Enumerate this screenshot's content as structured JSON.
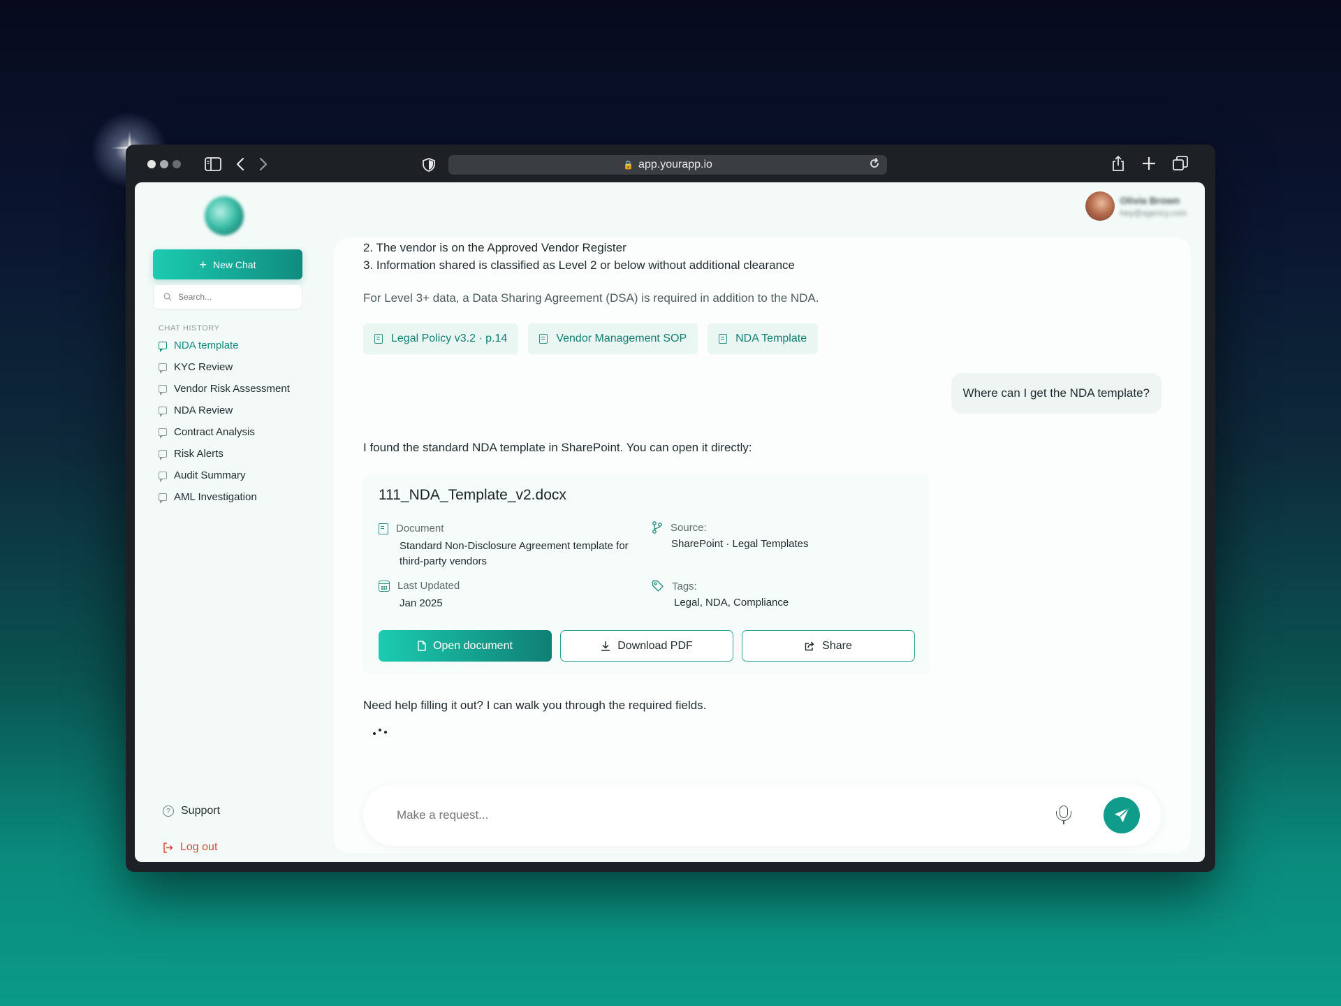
{
  "browser": {
    "url": "app.yourapp.io"
  },
  "sidebar": {
    "new_chat_label": "New Chat",
    "search_placeholder": "Search...",
    "history_label": "CHAT HISTORY",
    "items": [
      {
        "label": "NDA template",
        "active": true
      },
      {
        "label": "KYC Review",
        "active": false
      },
      {
        "label": "Vendor Risk Assessment",
        "active": false
      },
      {
        "label": "NDA Review",
        "active": false
      },
      {
        "label": "Contract Analysis",
        "active": false
      },
      {
        "label": "Risk Alerts",
        "active": false
      },
      {
        "label": "Audit Summary",
        "active": false
      },
      {
        "label": "AML Investigation",
        "active": false
      }
    ],
    "support_label": "Support",
    "logout_label": "Log out"
  },
  "profile": {
    "name": "Olivia Brown",
    "email": "hey@agency.com"
  },
  "chat": {
    "assistant_lines": [
      "2. The vendor is on the Approved Vendor Register",
      "3. Information shared is classified as Level 2 or below without additional clearance"
    ],
    "dsa_note": "For Level 3+ data, a Data Sharing Agreement (DSA) is required in addition to the NDA.",
    "sources": [
      "Legal Policy v3.2 · p.14",
      "Vendor Management SOP",
      "NDA Template"
    ],
    "user_message": "Where can I get the NDA template?",
    "assistant_reply": "I found the standard NDA template in SharePoint. You can open it directly:",
    "document": {
      "filename": "111_NDA_Template_v2.docx",
      "type_label": "Document",
      "type_value": "Standard Non-Disclosure Agreement template for third-party vendors",
      "source_label": "Source:",
      "source_value": "SharePoint · Legal Templates",
      "updated_label": "Last Updated",
      "updated_value": "Jan 2025",
      "tags_label": "Tags:",
      "tags_value": "Legal, NDA, Compliance",
      "open_label": "Open document",
      "download_label": "Download PDF",
      "share_label": "Share"
    },
    "followup": "Need help filling it out? I can walk you through the required fields.",
    "input_placeholder": "Make a request..."
  },
  "colors": {
    "accent": "#0f9c8a",
    "accent_light": "#1ccbb0",
    "danger": "#d4493b",
    "chip_bg": "#e9f6f2"
  }
}
